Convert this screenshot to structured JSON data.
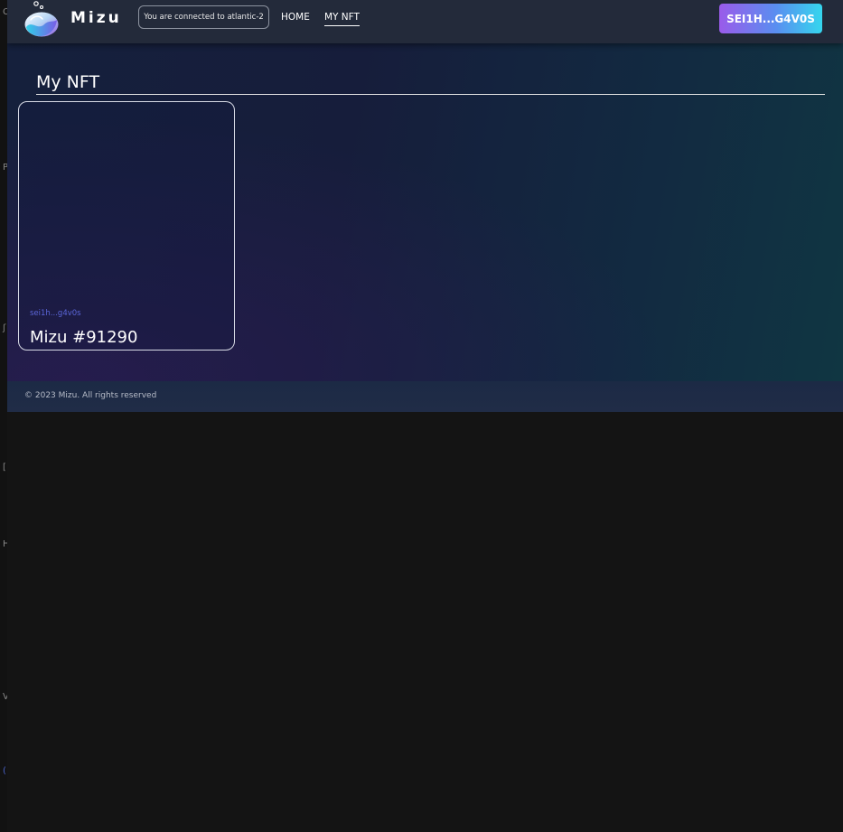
{
  "app": {
    "brand": "Mizu",
    "network_status": "You are connected to atlantic-2",
    "wallet_button_label": "SEI1H...G4V0S",
    "logo_icon": "mizu-water-drop-logo-icon"
  },
  "nav": {
    "items": [
      {
        "label": "HOME",
        "active": false
      },
      {
        "label": "MY NFT",
        "active": true
      }
    ]
  },
  "page": {
    "title": "My NFT"
  },
  "nfts": [
    {
      "owner": "sei1h...g4v0s",
      "name": "Mizu #91290"
    }
  ],
  "footer": {
    "text": "© 2023 Mizu. All rights reserved"
  },
  "left_strip": {
    "glyphs": [
      "C",
      "P",
      "ʃ",
      "[",
      "H",
      "V",
      "("
    ]
  },
  "colors": {
    "navbar": "#232a3a",
    "owner_text": "#5b66d9",
    "wallet_gradient_start": "#9a5bea",
    "wallet_gradient_end": "#35d6ee",
    "outer_background": "#141414"
  }
}
